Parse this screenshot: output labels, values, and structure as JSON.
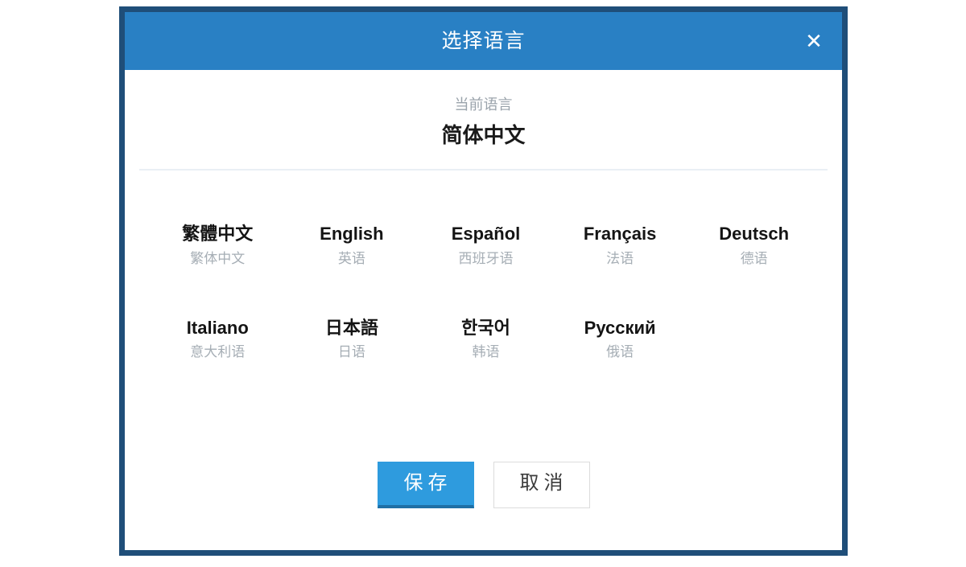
{
  "dialog": {
    "title": "选择语言",
    "close_icon": "close-icon",
    "close_glyph": "✕",
    "accent_color": "#2980c4",
    "border_color": "#1f4e79",
    "primary_button_color": "#2e9bde"
  },
  "current": {
    "label": "当前语言",
    "value": "简体中文"
  },
  "languages": [
    {
      "native": "繁體中文",
      "local": "繁体中文"
    },
    {
      "native": "English",
      "local": "英语"
    },
    {
      "native": "Español",
      "local": "西班牙语"
    },
    {
      "native": "Français",
      "local": "法语"
    },
    {
      "native": "Deutsch",
      "local": "德语"
    },
    {
      "native": "Italiano",
      "local": "意大利语"
    },
    {
      "native": "日本語",
      "local": "日语"
    },
    {
      "native": "한국어",
      "local": "韩语"
    },
    {
      "native": "Русский",
      "local": "俄语"
    }
  ],
  "footer": {
    "save_label": "保存",
    "cancel_label": "取消"
  }
}
